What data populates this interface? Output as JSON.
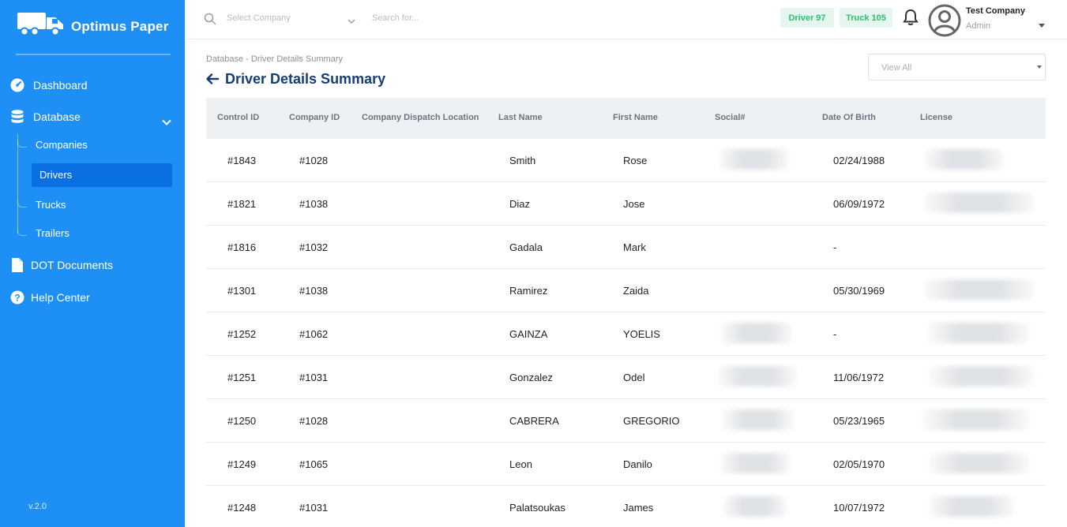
{
  "brand": {
    "name": "Optimus Paper"
  },
  "sidebar": {
    "items": [
      {
        "label": "Dashboard",
        "icon": "speedometer-icon"
      },
      {
        "label": "Database",
        "icon": "database-icon"
      },
      {
        "label": "DOT Documents",
        "icon": "document-icon"
      },
      {
        "label": "Help Center",
        "icon": "help-icon"
      }
    ],
    "database_sub": [
      {
        "label": "Companies"
      },
      {
        "label": "Drivers",
        "active": true
      },
      {
        "label": "Trucks"
      },
      {
        "label": "Trailers"
      }
    ],
    "version": "v.2.0"
  },
  "topbar": {
    "select_company_placeholder": "Select Company",
    "search_placeholder": "Search for...",
    "badges": [
      {
        "label": "Driver 97"
      },
      {
        "label": "Truck 105"
      }
    ],
    "user": {
      "company": "Test Company",
      "role": "Admin"
    }
  },
  "colors": {
    "sidebar": "#1e90f5",
    "active": "#0a6fe0",
    "title": "#173d74",
    "badge_text": "#2fbf71",
    "badge_bg": "#e6f6ee"
  },
  "breadcrumb": "Database - Driver Details Summary",
  "page_title": "Driver Details Summary",
  "filter": {
    "selected": "View All"
  },
  "table": {
    "columns": [
      "Control ID",
      "Company ID",
      "Company Dispatch Location",
      "Last Name",
      "First Name",
      "Social#",
      "Date Of Birth",
      "License"
    ],
    "rows": [
      {
        "control_id": "#1843",
        "company_id": "#1028",
        "location": "",
        "last_name": "Smith",
        "first_name": "Rose",
        "social_redacted": true,
        "dob": "02/24/1988",
        "license_redacted": true
      },
      {
        "control_id": "#1821",
        "company_id": "#1038",
        "location": "",
        "last_name": "Diaz",
        "first_name": "Jose",
        "social_redacted": false,
        "dob": "06/09/1972",
        "license_redacted": true
      },
      {
        "control_id": "#1816",
        "company_id": "#1032",
        "location": "",
        "last_name": "Gadala",
        "first_name": "Mark",
        "social_redacted": false,
        "dob": "-",
        "license_redacted": false
      },
      {
        "control_id": "#1301",
        "company_id": "#1038",
        "location": "",
        "last_name": "Ramirez",
        "first_name": "Zaida",
        "social_redacted": false,
        "dob": "05/30/1969",
        "license_redacted": true
      },
      {
        "control_id": "#1252",
        "company_id": "#1062",
        "location": "",
        "last_name": "GAINZA",
        "first_name": "YOELIS",
        "social_redacted": true,
        "dob": "-",
        "license_redacted": true
      },
      {
        "control_id": "#1251",
        "company_id": "#1031",
        "location": "",
        "last_name": "Gonzalez",
        "first_name": "Odel",
        "social_redacted": true,
        "dob": "11/06/1972",
        "license_redacted": true
      },
      {
        "control_id": "#1250",
        "company_id": "#1028",
        "location": "",
        "last_name": "CABRERA",
        "first_name": "GREGORIO",
        "social_redacted": true,
        "dob": "05/23/1965",
        "license_redacted": true
      },
      {
        "control_id": "#1249",
        "company_id": "#1065",
        "location": "",
        "last_name": "Leon",
        "first_name": "Danilo",
        "social_redacted": true,
        "dob": "02/05/1970",
        "license_redacted": true
      },
      {
        "control_id": "#1248",
        "company_id": "#1031",
        "location": "",
        "last_name": "Palatsoukas",
        "first_name": "James",
        "social_redacted": true,
        "dob": "10/07/1972",
        "license_redacted": true
      }
    ]
  }
}
